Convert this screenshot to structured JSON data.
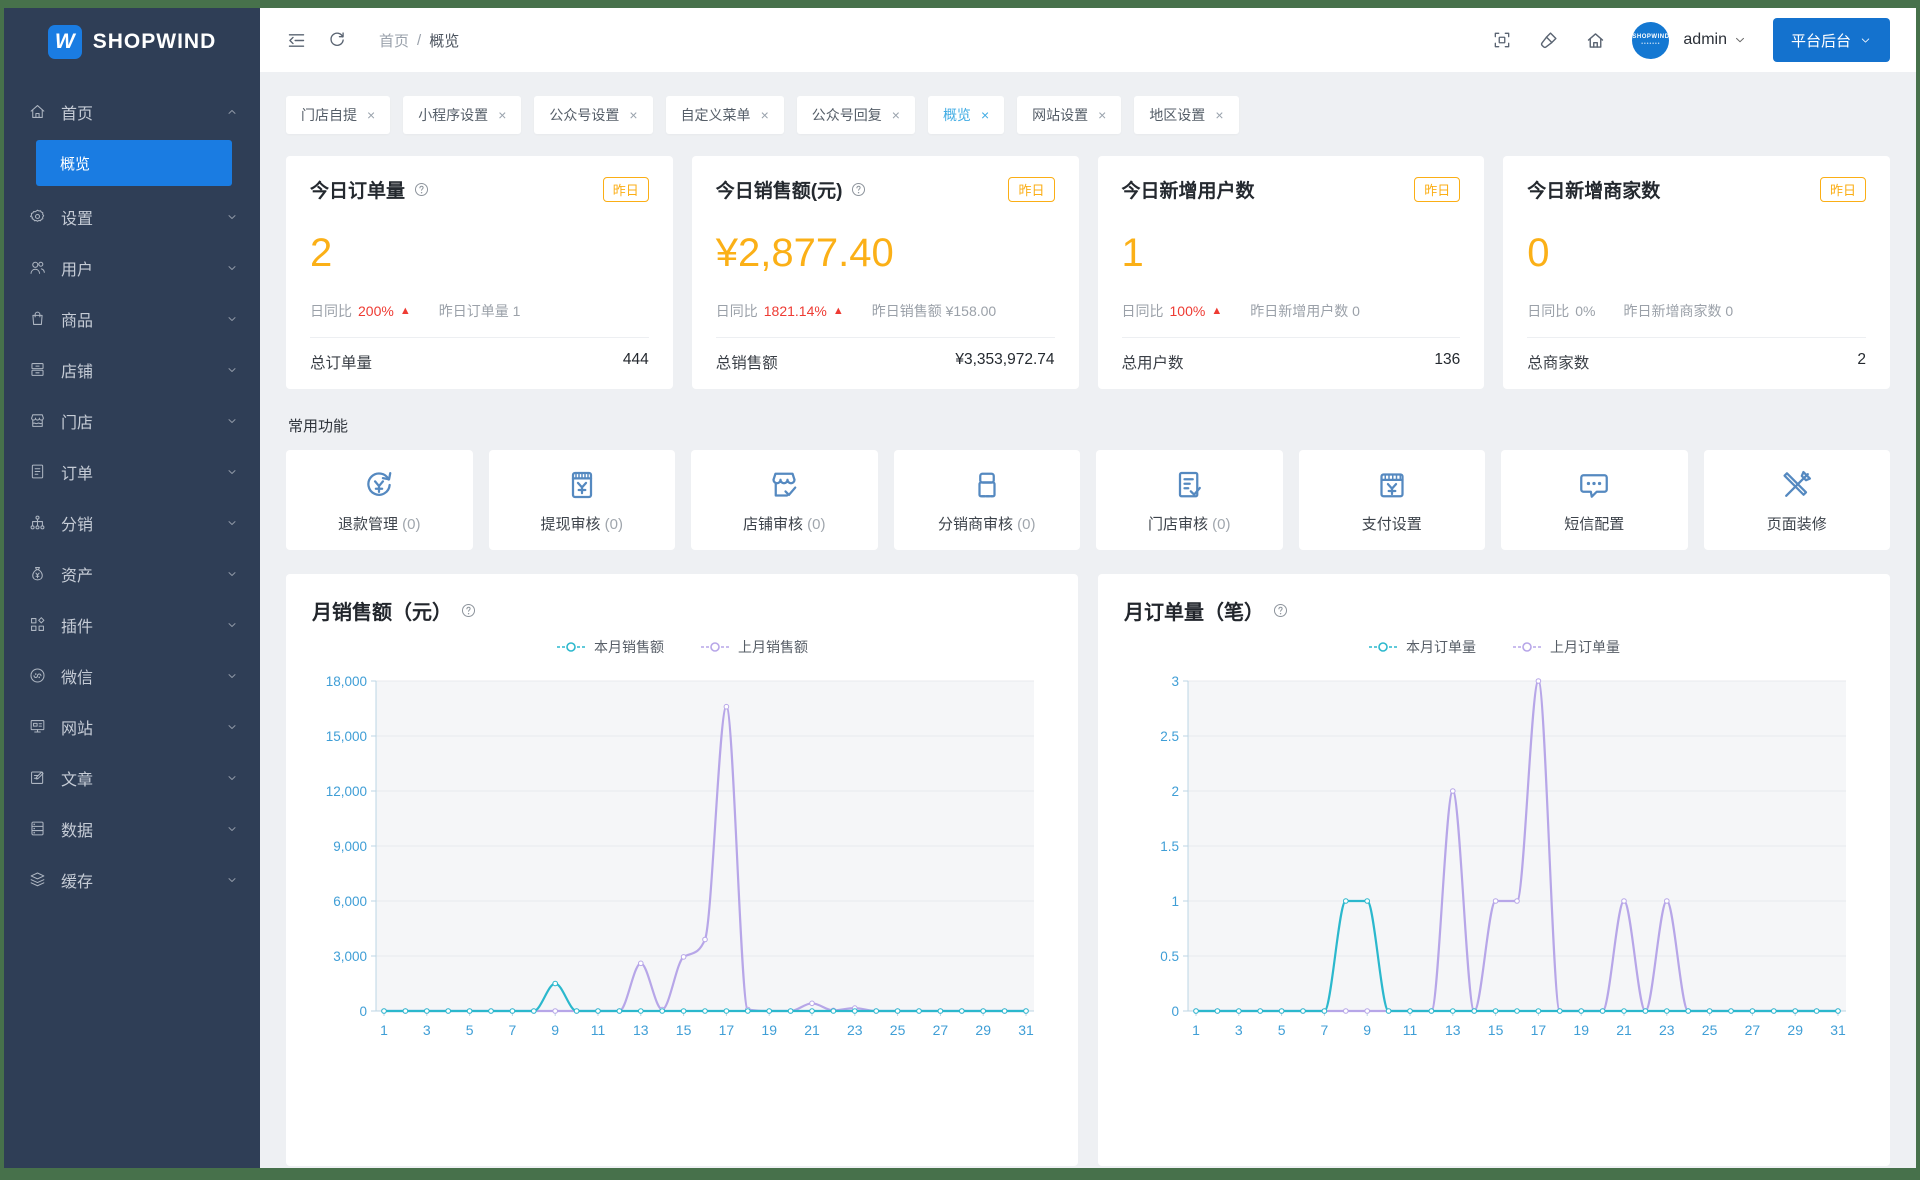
{
  "brand": {
    "logo_letter": "W",
    "name": "SHOPWIND"
  },
  "colors": {
    "frame_green": "#47714b",
    "sidebar": "#2f3e56",
    "active_blue": "#1a7ce2",
    "button_blue": "#1472ce",
    "tab_active": "#41ace4",
    "orange": "#fbb017",
    "red": "#ee3b33",
    "teal": "#2bb8cd",
    "purple": "#b7a6e8",
    "icon_blue": "#5589c0",
    "axis_label": "#3f9ed6",
    "axis_line": "#bcd6e4",
    "plot_bg": "#f5f6f8",
    "grid": "#e8eaee"
  },
  "sidebar": {
    "items": [
      {
        "id": "home",
        "label": "首页",
        "icon": "home",
        "open": true,
        "children": [
          {
            "id": "overview",
            "label": "概览",
            "active": true
          }
        ]
      },
      {
        "id": "settings",
        "label": "设置",
        "icon": "gear"
      },
      {
        "id": "users",
        "label": "用户",
        "icon": "users"
      },
      {
        "id": "goods",
        "label": "商品",
        "icon": "bag"
      },
      {
        "id": "shop",
        "label": "店铺",
        "icon": "shop"
      },
      {
        "id": "stores",
        "label": "门店",
        "icon": "store"
      },
      {
        "id": "orders",
        "label": "订单",
        "icon": "order"
      },
      {
        "id": "distribution",
        "label": "分销",
        "icon": "share"
      },
      {
        "id": "assets",
        "label": "资产",
        "icon": "asset"
      },
      {
        "id": "plugins",
        "label": "插件",
        "icon": "plugin"
      },
      {
        "id": "wechat",
        "label": "微信",
        "icon": "wechat"
      },
      {
        "id": "website",
        "label": "网站",
        "icon": "site"
      },
      {
        "id": "articles",
        "label": "文章",
        "icon": "article"
      },
      {
        "id": "data",
        "label": "数据",
        "icon": "data"
      },
      {
        "id": "cache",
        "label": "缓存",
        "icon": "cache"
      }
    ]
  },
  "header": {
    "breadcrumb": {
      "root": "首页",
      "separator": "/",
      "current": "概览"
    },
    "username": "admin",
    "avatar_text": "SHOPWIND",
    "platform_button": "平台后台"
  },
  "tabs": [
    {
      "label": "门店自提",
      "active": false
    },
    {
      "label": "小程序设置",
      "active": false
    },
    {
      "label": "公众号设置",
      "active": false
    },
    {
      "label": "自定义菜单",
      "active": false
    },
    {
      "label": "公众号回复",
      "active": false
    },
    {
      "label": "概览",
      "active": true
    },
    {
      "label": "网站设置",
      "active": false
    },
    {
      "label": "地区设置",
      "active": false
    }
  ],
  "stat_cards": [
    {
      "title": "今日订单量",
      "help": true,
      "badge": "昨日",
      "value": "2",
      "compare_label": "日同比",
      "compare_value": "200%",
      "trend": "up",
      "yesterday_text": "昨日订单量 1",
      "total_label": "总订单量",
      "total_value": "444"
    },
    {
      "title": "今日销售额(元)",
      "help": true,
      "badge": "昨日",
      "value": "¥2,877.40",
      "compare_label": "日同比",
      "compare_value": "1821.14%",
      "trend": "up",
      "yesterday_text": "昨日销售额 ¥158.00",
      "total_label": "总销售额",
      "total_value": "¥3,353,972.74"
    },
    {
      "title": "今日新增用户数",
      "help": false,
      "badge": "昨日",
      "value": "1",
      "compare_label": "日同比",
      "compare_value": "100%",
      "trend": "up",
      "yesterday_text": "昨日新增用户数 0",
      "total_label": "总用户数",
      "total_value": "136"
    },
    {
      "title": "今日新增商家数",
      "help": false,
      "badge": "昨日",
      "value": "0",
      "compare_label": "日同比",
      "compare_value": "0%",
      "trend": "none",
      "yesterday_text": "昨日新增商家数 0",
      "total_label": "总商家数",
      "total_value": "2"
    }
  ],
  "quick": {
    "title": "常用功能",
    "items": [
      {
        "label": "退款管理",
        "count": "(0)",
        "icon": "refund"
      },
      {
        "label": "提现审核",
        "count": "(0)",
        "icon": "withdraw"
      },
      {
        "label": "店铺审核",
        "count": "(0)",
        "icon": "shopcheck"
      },
      {
        "label": "分销商审核",
        "count": "(0)",
        "icon": "package"
      },
      {
        "label": "门店审核",
        "count": "(0)",
        "icon": "doccheck"
      },
      {
        "label": "支付设置",
        "count": "",
        "icon": "pay"
      },
      {
        "label": "短信配置",
        "count": "",
        "icon": "sms"
      },
      {
        "label": "页面装修",
        "count": "",
        "icon": "decorate"
      }
    ]
  },
  "chart_data": [
    {
      "type": "line",
      "title": "月销售额（元）",
      "x": [
        1,
        2,
        3,
        4,
        5,
        6,
        7,
        8,
        9,
        10,
        11,
        12,
        13,
        14,
        15,
        16,
        17,
        18,
        19,
        20,
        21,
        22,
        23,
        24,
        25,
        26,
        27,
        28,
        29,
        30,
        31
      ],
      "x_labeled": [
        1,
        3,
        5,
        7,
        9,
        11,
        13,
        15,
        17,
        19,
        21,
        23,
        25,
        27,
        29,
        31
      ],
      "ylim": [
        0,
        18000
      ],
      "ytick": 3000,
      "grid": true,
      "legend_position": "top",
      "series": [
        {
          "name": "本月销售额",
          "color": "#2bb8cd",
          "values": [
            0,
            0,
            0,
            0,
            0,
            0,
            0,
            0,
            1500,
            0,
            0,
            0,
            0,
            0,
            0,
            0,
            0,
            0,
            0,
            0,
            0,
            0,
            0,
            0,
            0,
            0,
            0,
            0,
            0,
            0,
            0
          ]
        },
        {
          "name": "上月销售额",
          "color": "#b7a6e8",
          "values": [
            0,
            0,
            0,
            0,
            0,
            0,
            0,
            0,
            0,
            0,
            0,
            0,
            2600,
            80,
            2950,
            3900,
            16600,
            80,
            0,
            0,
            420,
            30,
            160,
            0,
            0,
            0,
            0,
            0,
            0,
            0,
            0
          ]
        }
      ]
    },
    {
      "type": "line",
      "title": "月订单量（笔）",
      "x": [
        1,
        2,
        3,
        4,
        5,
        6,
        7,
        8,
        9,
        10,
        11,
        12,
        13,
        14,
        15,
        16,
        17,
        18,
        19,
        20,
        21,
        22,
        23,
        24,
        25,
        26,
        27,
        28,
        29,
        30,
        31
      ],
      "x_labeled": [
        1,
        3,
        5,
        7,
        9,
        11,
        13,
        15,
        17,
        19,
        21,
        23,
        25,
        27,
        29,
        31
      ],
      "ylim": [
        0,
        3
      ],
      "ytick": 0.5,
      "grid": true,
      "legend_position": "top",
      "series": [
        {
          "name": "本月订单量",
          "color": "#2bb8cd",
          "values": [
            0,
            0,
            0,
            0,
            0,
            0,
            0,
            1,
            1,
            0,
            0,
            0,
            0,
            0,
            0,
            0,
            0,
            0,
            0,
            0,
            0,
            0,
            0,
            0,
            0,
            0,
            0,
            0,
            0,
            0,
            0
          ]
        },
        {
          "name": "上月订单量",
          "color": "#b7a6e8",
          "values": [
            0,
            0,
            0,
            0,
            0,
            0,
            0,
            0,
            0,
            0,
            0,
            0,
            2,
            0,
            1,
            1,
            3,
            0,
            0,
            0,
            1,
            0,
            1,
            0,
            0,
            0,
            0,
            0,
            0,
            0,
            0
          ]
        }
      ]
    }
  ]
}
